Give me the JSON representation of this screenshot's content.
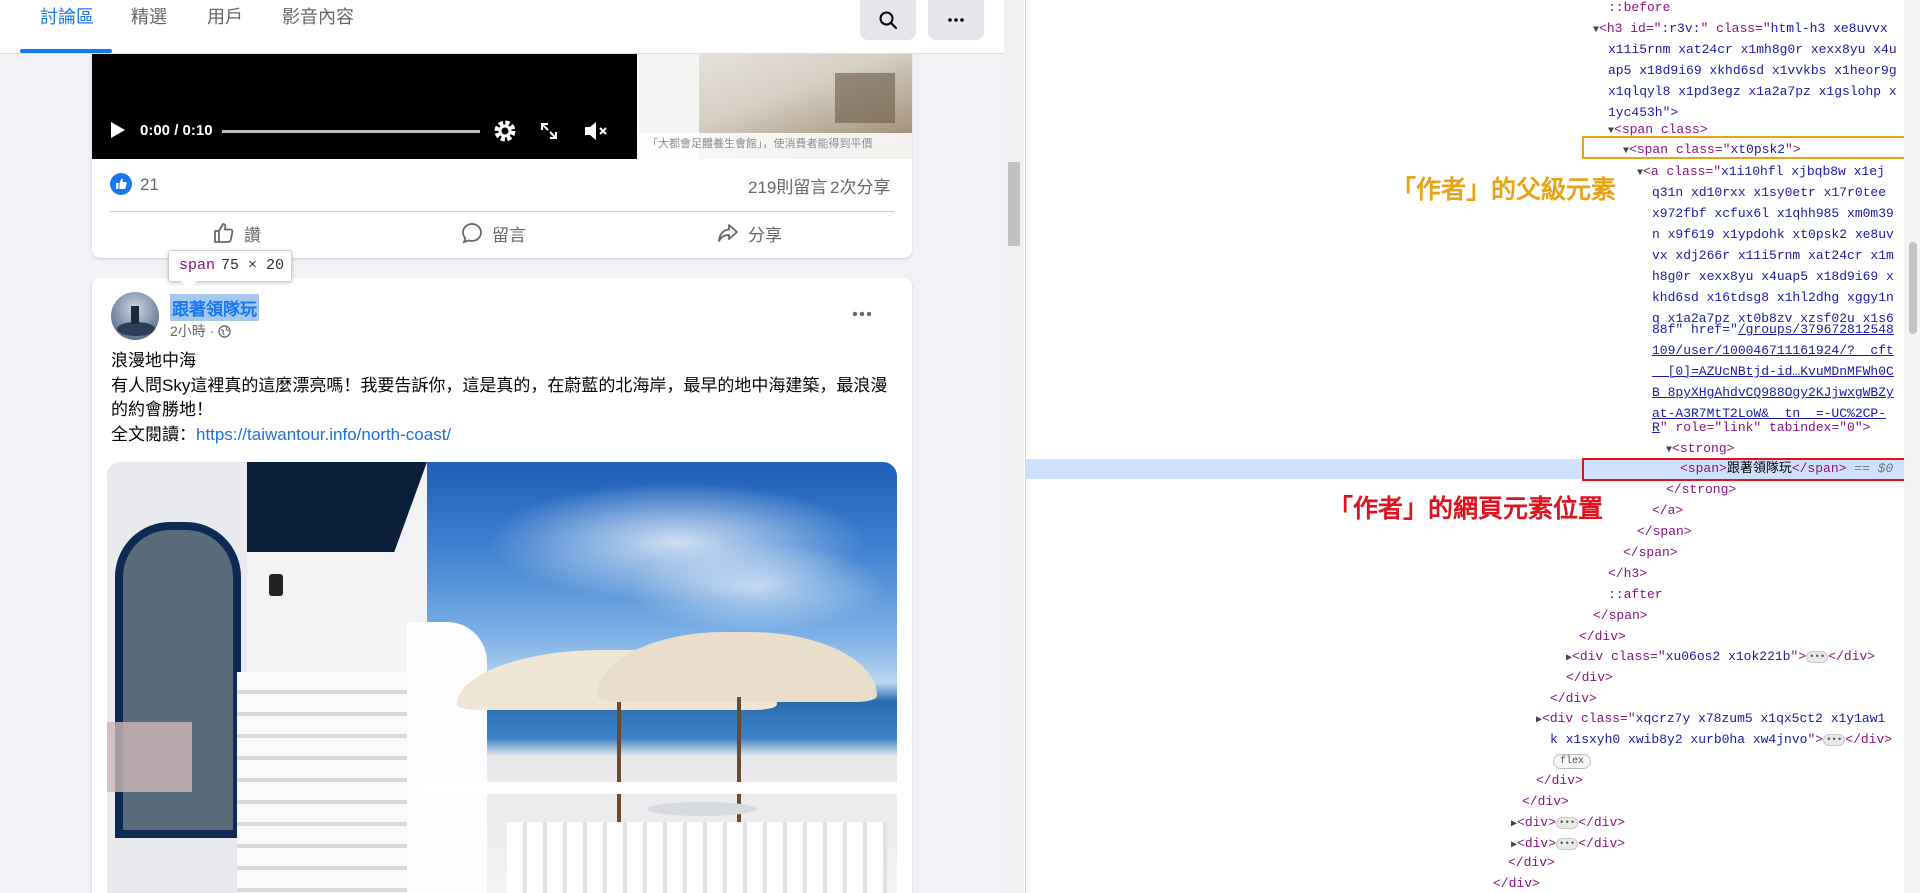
{
  "fb": {
    "tabs": [
      {
        "label": "討論區",
        "active": true
      },
      {
        "label": "精選",
        "active": false
      },
      {
        "label": "用戶",
        "active": false
      },
      {
        "label": "影音內容",
        "active": false
      }
    ],
    "search_icon": "search-icon",
    "more_icon": "more-horizontal-icon",
    "post1": {
      "video_time": "0:00 / 0:10",
      "photo_caption": "「大都會足體養生會館」，使消費者能得到平價",
      "like_count": "21",
      "comments": "219則留言",
      "shares": "2次分享",
      "actions": {
        "like": "讚",
        "comment": "留言",
        "share": "分享"
      }
    },
    "tooltip": {
      "tag": "span",
      "dims": "75 × 20"
    },
    "post2": {
      "author": "跟著領隊玩",
      "time": "2小時",
      "separator": "·",
      "title_line": "浪漫地中海",
      "body_line": "有人問Sky這裡真的這麼漂亮嗎！我要告訴你，這是真的，在蔚藍的北海岸，最早的地中海建築，最浪漫的約會勝地！",
      "read_more_label": "全文閱讀：",
      "link": "https://taiwantour.info/north-coast/"
    }
  },
  "devtools": {
    "lines": {
      "l1": "::before",
      "l2_a": "<h3 id=\"",
      "l2_id": ":r3v:",
      "l2_b": "\" class=\"",
      "l2_cls": "html-h3 xe8uvvx",
      "l3": "x11i5rnm xat24cr x1mh8g0r xexx8yu x4u",
      "l4": "ap5 x18d9i69 xkhd6sd x1vvkbs x1heor9g",
      "l5": "x1qlqyl8 x1pd3egz x1a2a7pz x1gslohp x",
      "l6": "1yc453h\">",
      "l7": "<span class>",
      "l8_a": "<span class=\"",
      "l8_cls": "xt0psk2",
      "l8_b": "\">",
      "l9_a": "<a class=\"",
      "l9_cls": "x1i10hfl xjbqb8w x1ej",
      "l10": "q31n xd10rxx x1sy0etr x17r0tee",
      "l11": "x972fbf xcfux6l x1qhh985 xm0m39",
      "l12": "n x9f619 x1ypdohk xt0psk2 xe8uv",
      "l13": "vx xdj266r x11i5rnm xat24cr x1m",
      "l14": "h8g0r xexx8yu x4uap5 x18d9i69 x",
      "l15": "khd6sd x16tdsg8 x1hl2dhg xggy1n",
      "l16": "q x1a2a7pz xt0b8zv xzsf02u x1s6",
      "l17_a": "88f\" href=\"",
      "l17_link": "/groups/379672812548",
      "l18": "109/user/100046711161924/?__cft",
      "l19": "__[0]=AZUcNBtjd-id…KvuMDnMFWh0C",
      "l20": "B_8pyXHgAhdvCQ988Ogy2KJjwxgWBZy",
      "l21": "at-A3R7MtT2LoW&__tn__=-UC%2CP-",
      "l22_link": "R",
      "l22_b": "\" role=\"link\" tabindex=\"0\">",
      "l23": "<strong>",
      "l24_a": "<span>",
      "l24_text": "跟著領隊玩",
      "l24_b": "</span>",
      "l24_eq": "== $0",
      "l25": "</strong>",
      "l26": "</a>",
      "l27": "</span>",
      "l28": "</span>",
      "l29": "</h3>",
      "l30": "::after",
      "l31": "</span>",
      "l32": "</div>",
      "l33_a": "<div class=\"",
      "l33_cls": "xu06os2 x1ok221b",
      "l33_b": "\">",
      "l33_c": "</div>",
      "l34": "</div>",
      "l35": "</div>",
      "l36_a": "<div class=\"",
      "l36_cls": "xqcrz7y x78zum5 x1qx5ct2 x1y1aw1",
      "l37_cls": "k x1sxyh0 xwib8y2 xurb0ha xw4jnvo",
      "l37_b": "\">",
      "l37_c": "</div>",
      "flex": "flex",
      "l38": "</div>",
      "l39": "</div>",
      "l40_a": "<div>",
      "l40_c": "</div>",
      "l41_a": "<div>",
      "l41_c": "</div>",
      "l42": "</div>",
      "l43": "</div>"
    },
    "annotation_parent": "「作者」的父級元素",
    "annotation_element": "「作者」的網頁元素位置"
  },
  "colors": {
    "fb_blue": "#1877f2",
    "orange": "#e8a317",
    "red": "#e0121f",
    "selected_row": "#cfe0fc"
  }
}
